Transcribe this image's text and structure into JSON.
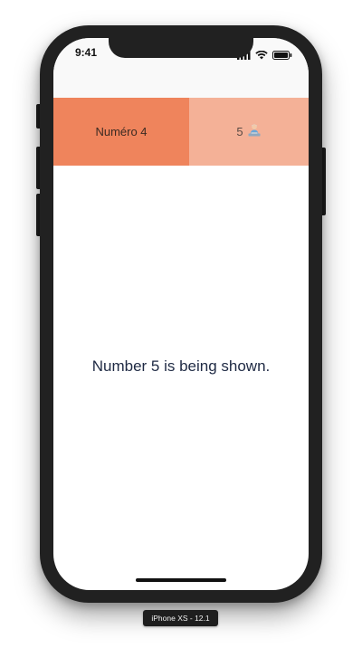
{
  "status_bar": {
    "time": "9:41",
    "icons": [
      "signal-icon",
      "wifi-icon",
      "battery-icon"
    ]
  },
  "tabs": [
    {
      "label": "Numéro 4",
      "color": "#ef845c",
      "selected": true
    },
    {
      "label": "5",
      "icon": "person-at-laptop-icon",
      "color": "#f4b197",
      "selected": false
    }
  ],
  "content": {
    "message": "Number 5 is being shown."
  },
  "device_label": "iPhone XS - 12.1"
}
